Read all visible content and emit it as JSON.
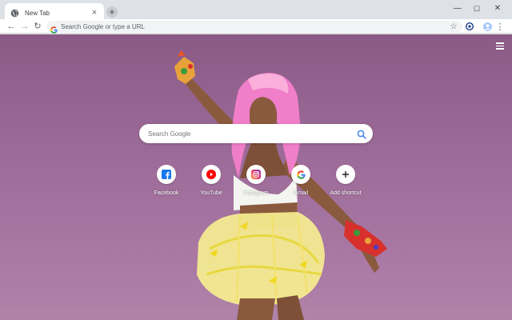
{
  "browser": {
    "tab_title": "New Tab",
    "tab_close": "×",
    "new_tab": "+",
    "win_min": "—",
    "win_max": "☐",
    "win_close": "✕"
  },
  "toolbar": {
    "back": "←",
    "forward": "→",
    "reload": "↻",
    "omnibox_placeholder": "Search Google or type a URL",
    "star": "☆",
    "menu": "⋮"
  },
  "page": {
    "search_placeholder": "Search Google",
    "shortcuts": [
      {
        "label": "Facebook",
        "icon": "facebook-icon",
        "color": "#1877f2"
      },
      {
        "label": "YouTube",
        "icon": "youtube-icon",
        "color": "#ff0000"
      },
      {
        "label": "Instagram",
        "icon": "instagram-icon",
        "color": "#c13584"
      },
      {
        "label": "Gmail",
        "icon": "google-icon",
        "color": "#4285f4"
      },
      {
        "label": "Add shortcut",
        "icon": "plus-icon",
        "color": "#202124"
      }
    ]
  }
}
